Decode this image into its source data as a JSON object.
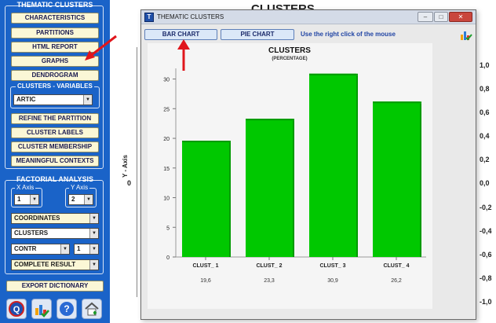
{
  "left_panel": {
    "thematic_clusters_title": "THEMATIC CLUSTERS",
    "buttons": {
      "characteristics": "CHARACTERISTICS",
      "partitions": "PARTITIONS",
      "html_report": "HTML REPORT",
      "graphs": "GRAPHS",
      "dendrogram": "DENDROGRAM",
      "refine_partition": "REFINE THE PARTITION",
      "cluster_labels": "CLUSTER LABELS",
      "cluster_membership": "CLUSTER MEMBERSHIP",
      "meaningful_contexts": "MEANINGFUL CONTEXTS"
    },
    "clusters_variables": {
      "label": "CLUSTERS - VARIABLES",
      "selected": "ARTIC"
    },
    "factorial_analysis": {
      "title": "FACTORIAL ANALYSIS",
      "x_axis_label": "X Axis",
      "x_axis_value": "1",
      "y_axis_label": "Y Axis",
      "y_axis_value": "2",
      "coordinates": "COORDINATES",
      "clusters": "CLUSTERS",
      "contr": "CONTR",
      "contr_number": "1",
      "complete_result": "COMPLETE RESULT",
      "export_dictionary": "EXPORT DICTIONARY"
    },
    "bottom_icons": [
      "q-logo-icon",
      "chart-check-icon",
      "help-icon",
      "home-icon"
    ]
  },
  "background": {
    "title": "CLUSTERS",
    "y_axis_label": "Y - Axis",
    "zero_label": "0",
    "right_ticks": [
      "1,0",
      "0,8",
      "0,6",
      "0,4",
      "0,2",
      "0,0",
      "-0,2",
      "-0,4",
      "-0,6",
      "-0,8",
      "-1,0"
    ]
  },
  "window": {
    "title": "THEMATIC CLUSTERS",
    "app_icon_letter": "T",
    "controls": {
      "minimize": "–",
      "maximize": "□",
      "close": "✕"
    },
    "bar_chart_button": "BAR CHART",
    "pie_chart_button": "PIE CHART",
    "hint": "Use the right click of the mouse"
  },
  "colors": {
    "panel_blue": "#1a63c8",
    "button_yellow": "#fbf7d6",
    "bar_green": "#00c800",
    "arrow_red": "#e0161c"
  },
  "chart_data": {
    "type": "bar",
    "title": "CLUSTERS",
    "subtitle": "(PERCENTAGE)",
    "categories": [
      "CLUST_ 1",
      "CLUST_ 2",
      "CLUST_ 3",
      "CLUST_ 4"
    ],
    "values": [
      19.6,
      23.3,
      30.9,
      26.2
    ],
    "value_labels": [
      "19,6",
      "23,3",
      "30,9",
      "26,2"
    ],
    "y_ticks": [
      0,
      5,
      10,
      15,
      20,
      25,
      30
    ],
    "ylim": [
      0,
      31
    ],
    "grid": false,
    "legend": "none"
  }
}
